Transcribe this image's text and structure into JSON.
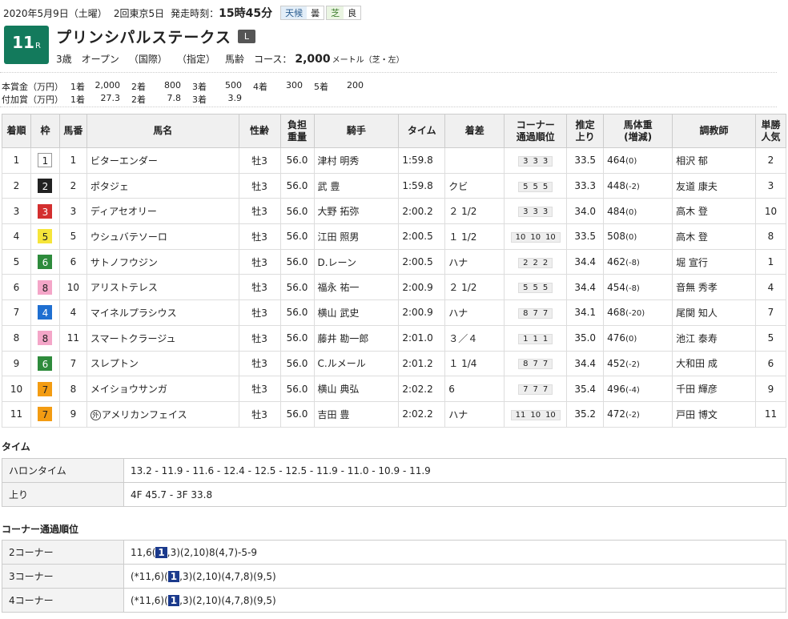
{
  "header": {
    "date": "2020年5月9日（土曜）",
    "meeting": "2回東京5日",
    "start_label": "発走時刻：",
    "start_time": "15時45分",
    "weather_label": "天候",
    "weather": "曇",
    "track_label": "芝",
    "track_condition": "良"
  },
  "race": {
    "number": "11",
    "r": "R",
    "name": "プリンシパルステークス",
    "grade": "L",
    "age": "3歳",
    "class": "オープン",
    "intl": "（国際）",
    "designated": "（指定）",
    "weight_rule": "馬齢",
    "course_label": "コース：",
    "distance": "2,000",
    "distance_unit": "メートル（芝・左）"
  },
  "prize": {
    "main_label": "本賞金（万円）",
    "main": [
      {
        "pos": "1着",
        "val": "2,000"
      },
      {
        "pos": "2着",
        "val": "800"
      },
      {
        "pos": "3着",
        "val": "500"
      },
      {
        "pos": "4着",
        "val": "300"
      },
      {
        "pos": "5着",
        "val": "200"
      }
    ],
    "add_label": "付加賞（万円）",
    "add": [
      {
        "pos": "1着",
        "val": "27.3"
      },
      {
        "pos": "2着",
        "val": "7.8"
      },
      {
        "pos": "3着",
        "val": "3.9"
      }
    ]
  },
  "table": {
    "headers": [
      "着順",
      "枠",
      "馬番",
      "馬名",
      "性齢",
      "負担\n重量",
      "騎手",
      "タイム",
      "着差",
      "コーナー\n通過順位",
      "推定\n上り",
      "馬体重\n(増減)",
      "調教師",
      "単勝\n人気"
    ],
    "rows": [
      {
        "rank": "1",
        "waku": "1",
        "num": "1",
        "name": "ビターエンダー",
        "gai": "",
        "sex": "牡3",
        "wt": "56.0",
        "jockey": "津村 明秀",
        "time": "1:59.8",
        "margin": "",
        "corner": [
          "3",
          "3",
          "3"
        ],
        "agari": "33.5",
        "bw": "464",
        "bwd": "(0)",
        "trainer": "相沢 郁",
        "pop": "2"
      },
      {
        "rank": "2",
        "waku": "2",
        "num": "2",
        "name": "ポタジェ",
        "gai": "",
        "sex": "牡3",
        "wt": "56.0",
        "jockey": "武 豊",
        "time": "1:59.8",
        "margin": "クビ",
        "corner": [
          "5",
          "5",
          "5"
        ],
        "agari": "33.3",
        "bw": "448",
        "bwd": "(-2)",
        "trainer": "友道 康夫",
        "pop": "3"
      },
      {
        "rank": "3",
        "waku": "3",
        "num": "3",
        "name": "ディアセオリー",
        "gai": "",
        "sex": "牡3",
        "wt": "56.0",
        "jockey": "大野 拓弥",
        "time": "2:00.2",
        "margin": "２ 1/2",
        "corner": [
          "3",
          "3",
          "3"
        ],
        "agari": "34.0",
        "bw": "484",
        "bwd": "(0)",
        "trainer": "高木 登",
        "pop": "10"
      },
      {
        "rank": "4",
        "waku": "5",
        "num": "5",
        "name": "ウシュバテソーロ",
        "gai": "",
        "sex": "牡3",
        "wt": "56.0",
        "jockey": "江田 照男",
        "time": "2:00.5",
        "margin": "１ 1/2",
        "corner": [
          "10",
          "10",
          "10"
        ],
        "agari": "33.5",
        "bw": "508",
        "bwd": "(0)",
        "trainer": "高木 登",
        "pop": "8"
      },
      {
        "rank": "5",
        "waku": "6",
        "num": "6",
        "name": "サトノフウジン",
        "gai": "",
        "sex": "牡3",
        "wt": "56.0",
        "jockey": "D.レーン",
        "time": "2:00.5",
        "margin": "ハナ",
        "corner": [
          "2",
          "2",
          "2"
        ],
        "agari": "34.4",
        "bw": "462",
        "bwd": "(-8)",
        "trainer": "堀 宣行",
        "pop": "1"
      },
      {
        "rank": "6",
        "waku": "8",
        "num": "10",
        "name": "アリストテレス",
        "gai": "",
        "sex": "牡3",
        "wt": "56.0",
        "jockey": "福永 祐一",
        "time": "2:00.9",
        "margin": "２ 1/2",
        "corner": [
          "5",
          "5",
          "5"
        ],
        "agari": "34.4",
        "bw": "454",
        "bwd": "(-8)",
        "trainer": "音無 秀孝",
        "pop": "4"
      },
      {
        "rank": "7",
        "waku": "4",
        "num": "4",
        "name": "マイネルプラシウス",
        "gai": "",
        "sex": "牡3",
        "wt": "56.0",
        "jockey": "横山 武史",
        "time": "2:00.9",
        "margin": "ハナ",
        "corner": [
          "8",
          "7",
          "7"
        ],
        "agari": "34.1",
        "bw": "468",
        "bwd": "(-20)",
        "trainer": "尾関 知人",
        "pop": "7"
      },
      {
        "rank": "8",
        "waku": "8",
        "num": "11",
        "name": "スマートクラージュ",
        "gai": "",
        "sex": "牡3",
        "wt": "56.0",
        "jockey": "藤井 勘一郎",
        "time": "2:01.0",
        "margin": "３／４",
        "corner": [
          "1",
          "1",
          "1"
        ],
        "agari": "35.0",
        "bw": "476",
        "bwd": "(0)",
        "trainer": "池江 泰寿",
        "pop": "5"
      },
      {
        "rank": "9",
        "waku": "6",
        "num": "7",
        "name": "スレプトン",
        "gai": "",
        "sex": "牡3",
        "wt": "56.0",
        "jockey": "C.ルメール",
        "time": "2:01.2",
        "margin": "１ 1/4",
        "corner": [
          "8",
          "7",
          "7"
        ],
        "agari": "34.4",
        "bw": "452",
        "bwd": "(-2)",
        "trainer": "大和田 成",
        "pop": "6"
      },
      {
        "rank": "10",
        "waku": "7",
        "num": "8",
        "name": "メイショウサンガ",
        "gai": "",
        "sex": "牡3",
        "wt": "56.0",
        "jockey": "横山 典弘",
        "time": "2:02.2",
        "margin": "6",
        "corner": [
          "7",
          "7",
          "7"
        ],
        "agari": "35.4",
        "bw": "496",
        "bwd": "(-4)",
        "trainer": "千田 輝彦",
        "pop": "9"
      },
      {
        "rank": "11",
        "waku": "7",
        "num": "9",
        "name": "アメリカンフェイス",
        "gai": "外",
        "sex": "牡3",
        "wt": "56.0",
        "jockey": "吉田 豊",
        "time": "2:02.2",
        "margin": "ハナ",
        "corner": [
          "11",
          "10",
          "10"
        ],
        "agari": "35.2",
        "bw": "472",
        "bwd": "(-2)",
        "trainer": "戸田 博文",
        "pop": "11"
      }
    ]
  },
  "times": {
    "title": "タイム",
    "furlong_label": "ハロンタイム",
    "furlong": "13.2 - 11.9 - 11.6 - 12.4 - 12.5 - 12.5 - 11.9 - 11.0 - 10.9 - 11.9",
    "agari_label": "上り",
    "agari": "4F 45.7 - 3F 33.8"
  },
  "corners": {
    "title": "コーナー通過順位",
    "rows": [
      {
        "label": "2コーナー",
        "pre": "11,6(",
        "hl": "1",
        "post": ",3)(2,10)8(4,7)-5-9"
      },
      {
        "label": "3コーナー",
        "pre": "(*11,6)(",
        "hl": "1",
        "post": ",3)(2,10)(4,7,8)(9,5)"
      },
      {
        "label": "4コーナー",
        "pre": "(*11,6)(",
        "hl": "1",
        "post": ",3)(2,10)(4,7,8)(9,5)"
      }
    ]
  }
}
